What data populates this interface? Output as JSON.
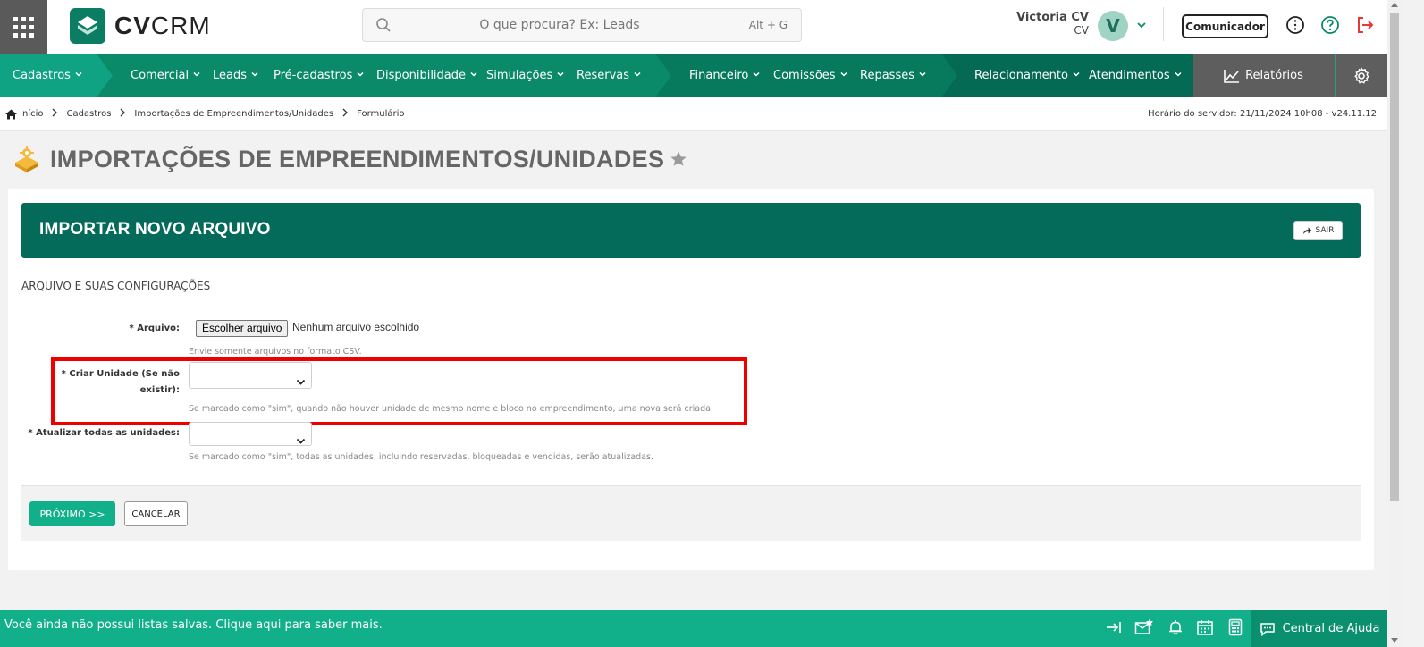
{
  "header": {
    "logo_bold": "CV",
    "logo_light": "CRM",
    "search_placeholder": "O que procura? Ex: Leads",
    "search_shortcut": "Alt + G",
    "user_name": "Victoria CV",
    "user_sub": "CV",
    "avatar_letter": "V",
    "comunicador": "Comunicador"
  },
  "nav": {
    "items": [
      "Cadastros",
      "Comercial",
      "Leads",
      "Pré-cadastros",
      "Disponibilidade",
      "Simulações",
      "Reservas",
      "Financeiro",
      "Comissões",
      "Repasses",
      "Relacionamento",
      "Atendimentos"
    ],
    "relatorios": "Relatórios"
  },
  "breadcrumb": {
    "items": [
      "Início",
      "Cadastros",
      "Importações de Empreendimentos/Unidades",
      "Formulário"
    ],
    "server_time": "Horário do servidor: 21/11/2024 10h08 - v24.11.12"
  },
  "page": {
    "title": "IMPORTAÇÕES DE EMPREENDIMENTOS/UNIDADES"
  },
  "card": {
    "title": "IMPORTAR NOVO ARQUIVO",
    "exit": "SAIR",
    "section": "ARQUIVO E SUAS CONFIGURAÇÕES",
    "fields": {
      "arquivo_label": "* Arquivo:",
      "file_button": "Escolher arquivo",
      "file_status": "Nenhum arquivo escolhido",
      "arquivo_help": "Envie somente arquivos no formato CSV.",
      "criar_label_1": "* Criar Unidade (Se não",
      "criar_label_2": "existir):",
      "criar_help": "Se marcado como \"sim\", quando não houver unidade de mesmo nome e bloco no empreendimento, uma nova será criada.",
      "atualizar_label": "* Atualizar todas as unidades:",
      "atualizar_help": "Se marcado como \"sim\", todas as unidades, incluindo reservadas, bloqueadas e vendidas, serão atualizadas."
    },
    "next": "PRÓXIMO >>",
    "cancel": "CANCELAR"
  },
  "bottom": {
    "message": "Você ainda não possui listas salvas. Clique aqui para saber mais.",
    "help_center": "Central de Ajuda"
  },
  "colors": {
    "brand_green": "#0b8a6a",
    "dark_green": "#046b5a",
    "accent_green": "#12b08a",
    "highlight_red": "#e00000"
  }
}
